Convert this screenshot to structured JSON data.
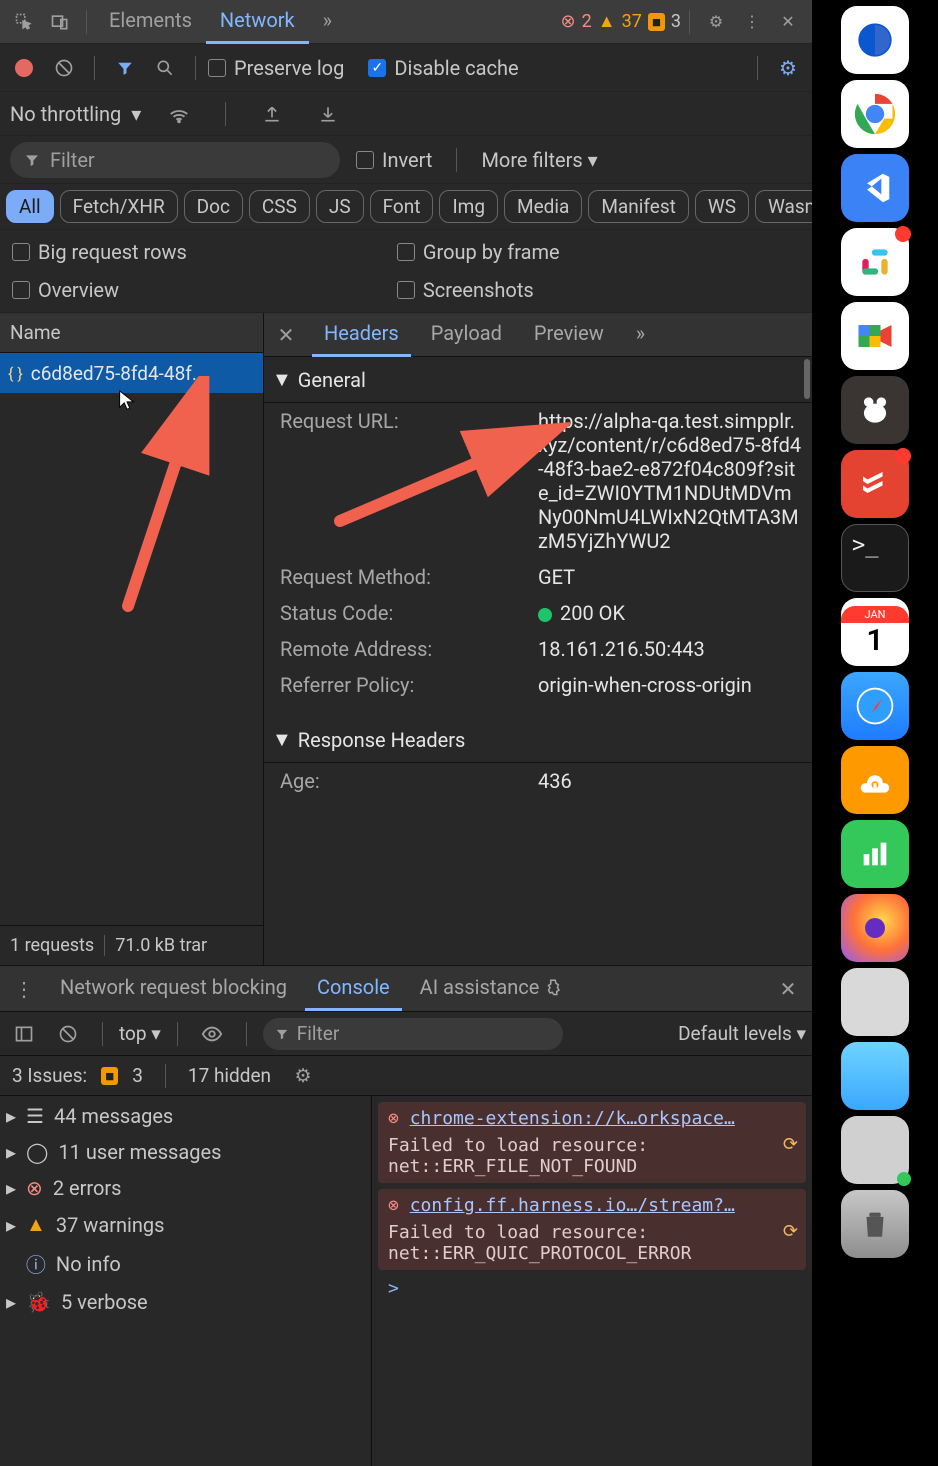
{
  "topTabs": {
    "elements": "Elements",
    "network": "Network",
    "more": "»"
  },
  "statusCounts": {
    "errors": "2",
    "warnings": "37",
    "flags": "3"
  },
  "toolbar": {
    "preserveLog": "Preserve log",
    "disableCache": "Disable cache"
  },
  "throttling": {
    "label": "No throttling"
  },
  "filter": {
    "placeholder": "Filter",
    "invert": "Invert",
    "moreFilters": "More filters"
  },
  "chips": {
    "all": "All",
    "fetch": "Fetch/XHR",
    "doc": "Doc",
    "css": "CSS",
    "js": "JS",
    "font": "Font",
    "img": "Img",
    "media": "Media",
    "manifest": "Manifest",
    "ws": "WS",
    "wasm": "Wasm"
  },
  "checks": {
    "bigRows": "Big request rows",
    "overview": "Overview",
    "groupFrame": "Group by frame",
    "screenshots": "Screenshots"
  },
  "nameHeader": "Name",
  "requestName": "c6d8ed75-8fd4-48f...",
  "footer": {
    "requests": "1 requests",
    "transferred": "71.0 kB trar"
  },
  "detailTabs": {
    "headers": "Headers",
    "payload": "Payload",
    "preview": "Preview",
    "more": "»"
  },
  "sections": {
    "general": "General",
    "responseHeaders": "Response Headers"
  },
  "general": {
    "urlLabel": "Request URL:",
    "urlValue": "https://alpha-qa.test.simpplr.xyz/content/r/c6d8ed75-8fd4-48f3-bae2-e872f04c809f?site_id=ZWI0YTM1NDUtMDVmNy00NmU4LWIxN2QtMTA3MzM5YjZhYWU2",
    "methodLabel": "Request Method:",
    "methodValue": "GET",
    "statusLabel": "Status Code:",
    "statusValue": "200 OK",
    "remoteLabel": "Remote Address:",
    "remoteValue": "18.161.216.50:443",
    "referrerLabel": "Referrer Policy:",
    "referrerValue": "origin-when-cross-origin"
  },
  "responseHeaders": {
    "ageLabel": "Age:",
    "ageValue": "436"
  },
  "drawerTabsRow": {
    "blocking": "Network request blocking",
    "console": "Console",
    "ai": "AI assistance"
  },
  "consoleTool": {
    "scope": "top",
    "filterPlaceholder": "Filter",
    "levels": "Default levels"
  },
  "issues": {
    "label": "3 Issues:",
    "count": "3",
    "hidden": "17 hidden"
  },
  "msgSummary": {
    "messages": "44 messages",
    "userMessages": "11 user messages",
    "errors": "2 errors",
    "warnings": "37 warnings",
    "info": "No info",
    "verbose": "5 verbose"
  },
  "consoleErrors": [
    {
      "link": "chrome-extension://k…orkspace…",
      "text": "Failed to load resource: net::ERR_FILE_NOT_FOUND"
    },
    {
      "link": "config.ff.harness.io…/stream?…",
      "text": "Failed to load resource: net::ERR_QUIC_PROTOCOL_ERROR"
    }
  ],
  "prompt": ">",
  "dock": {
    "edge": "#0b57d0",
    "chrome": "#ea4335",
    "vscode": "#3b82f6",
    "slack": "#e01e5a",
    "meet": "#34a853",
    "amazon": "#5a4632",
    "todoist": "#e44332",
    "terminal": "#222",
    "calendar": "#fff",
    "appstore": "#1f7cff",
    "aws": "#ff9900",
    "numbers": "#34c759",
    "firefox": "#ff7139",
    "notes": "#bfbfbf",
    "finder": "#3aa8ff",
    "trash": "#9aa0a6"
  },
  "calendarMonth": "JAN",
  "calendarDay": "1"
}
